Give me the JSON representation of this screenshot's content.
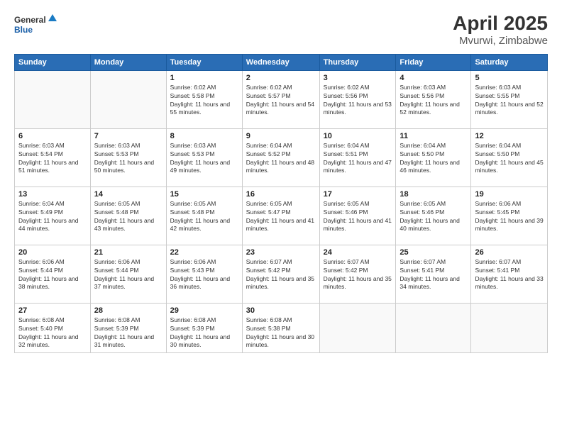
{
  "logo": {
    "general": "General",
    "blue": "Blue"
  },
  "title": "April 2025",
  "subtitle": "Mvurwi, Zimbabwe",
  "headers": [
    "Sunday",
    "Monday",
    "Tuesday",
    "Wednesday",
    "Thursday",
    "Friday",
    "Saturday"
  ],
  "weeks": [
    [
      {
        "day": "",
        "sunrise": "",
        "sunset": "",
        "daylight": ""
      },
      {
        "day": "",
        "sunrise": "",
        "sunset": "",
        "daylight": ""
      },
      {
        "day": "1",
        "sunrise": "Sunrise: 6:02 AM",
        "sunset": "Sunset: 5:58 PM",
        "daylight": "Daylight: 11 hours and 55 minutes."
      },
      {
        "day": "2",
        "sunrise": "Sunrise: 6:02 AM",
        "sunset": "Sunset: 5:57 PM",
        "daylight": "Daylight: 11 hours and 54 minutes."
      },
      {
        "day": "3",
        "sunrise": "Sunrise: 6:02 AM",
        "sunset": "Sunset: 5:56 PM",
        "daylight": "Daylight: 11 hours and 53 minutes."
      },
      {
        "day": "4",
        "sunrise": "Sunrise: 6:03 AM",
        "sunset": "Sunset: 5:56 PM",
        "daylight": "Daylight: 11 hours and 52 minutes."
      },
      {
        "day": "5",
        "sunrise": "Sunrise: 6:03 AM",
        "sunset": "Sunset: 5:55 PM",
        "daylight": "Daylight: 11 hours and 52 minutes."
      }
    ],
    [
      {
        "day": "6",
        "sunrise": "Sunrise: 6:03 AM",
        "sunset": "Sunset: 5:54 PM",
        "daylight": "Daylight: 11 hours and 51 minutes."
      },
      {
        "day": "7",
        "sunrise": "Sunrise: 6:03 AM",
        "sunset": "Sunset: 5:53 PM",
        "daylight": "Daylight: 11 hours and 50 minutes."
      },
      {
        "day": "8",
        "sunrise": "Sunrise: 6:03 AM",
        "sunset": "Sunset: 5:53 PM",
        "daylight": "Daylight: 11 hours and 49 minutes."
      },
      {
        "day": "9",
        "sunrise": "Sunrise: 6:04 AM",
        "sunset": "Sunset: 5:52 PM",
        "daylight": "Daylight: 11 hours and 48 minutes."
      },
      {
        "day": "10",
        "sunrise": "Sunrise: 6:04 AM",
        "sunset": "Sunset: 5:51 PM",
        "daylight": "Daylight: 11 hours and 47 minutes."
      },
      {
        "day": "11",
        "sunrise": "Sunrise: 6:04 AM",
        "sunset": "Sunset: 5:50 PM",
        "daylight": "Daylight: 11 hours and 46 minutes."
      },
      {
        "day": "12",
        "sunrise": "Sunrise: 6:04 AM",
        "sunset": "Sunset: 5:50 PM",
        "daylight": "Daylight: 11 hours and 45 minutes."
      }
    ],
    [
      {
        "day": "13",
        "sunrise": "Sunrise: 6:04 AM",
        "sunset": "Sunset: 5:49 PM",
        "daylight": "Daylight: 11 hours and 44 minutes."
      },
      {
        "day": "14",
        "sunrise": "Sunrise: 6:05 AM",
        "sunset": "Sunset: 5:48 PM",
        "daylight": "Daylight: 11 hours and 43 minutes."
      },
      {
        "day": "15",
        "sunrise": "Sunrise: 6:05 AM",
        "sunset": "Sunset: 5:48 PM",
        "daylight": "Daylight: 11 hours and 42 minutes."
      },
      {
        "day": "16",
        "sunrise": "Sunrise: 6:05 AM",
        "sunset": "Sunset: 5:47 PM",
        "daylight": "Daylight: 11 hours and 41 minutes."
      },
      {
        "day": "17",
        "sunrise": "Sunrise: 6:05 AM",
        "sunset": "Sunset: 5:46 PM",
        "daylight": "Daylight: 11 hours and 41 minutes."
      },
      {
        "day": "18",
        "sunrise": "Sunrise: 6:05 AM",
        "sunset": "Sunset: 5:46 PM",
        "daylight": "Daylight: 11 hours and 40 minutes."
      },
      {
        "day": "19",
        "sunrise": "Sunrise: 6:06 AM",
        "sunset": "Sunset: 5:45 PM",
        "daylight": "Daylight: 11 hours and 39 minutes."
      }
    ],
    [
      {
        "day": "20",
        "sunrise": "Sunrise: 6:06 AM",
        "sunset": "Sunset: 5:44 PM",
        "daylight": "Daylight: 11 hours and 38 minutes."
      },
      {
        "day": "21",
        "sunrise": "Sunrise: 6:06 AM",
        "sunset": "Sunset: 5:44 PM",
        "daylight": "Daylight: 11 hours and 37 minutes."
      },
      {
        "day": "22",
        "sunrise": "Sunrise: 6:06 AM",
        "sunset": "Sunset: 5:43 PM",
        "daylight": "Daylight: 11 hours and 36 minutes."
      },
      {
        "day": "23",
        "sunrise": "Sunrise: 6:07 AM",
        "sunset": "Sunset: 5:42 PM",
        "daylight": "Daylight: 11 hours and 35 minutes."
      },
      {
        "day": "24",
        "sunrise": "Sunrise: 6:07 AM",
        "sunset": "Sunset: 5:42 PM",
        "daylight": "Daylight: 11 hours and 35 minutes."
      },
      {
        "day": "25",
        "sunrise": "Sunrise: 6:07 AM",
        "sunset": "Sunset: 5:41 PM",
        "daylight": "Daylight: 11 hours and 34 minutes."
      },
      {
        "day": "26",
        "sunrise": "Sunrise: 6:07 AM",
        "sunset": "Sunset: 5:41 PM",
        "daylight": "Daylight: 11 hours and 33 minutes."
      }
    ],
    [
      {
        "day": "27",
        "sunrise": "Sunrise: 6:08 AM",
        "sunset": "Sunset: 5:40 PM",
        "daylight": "Daylight: 11 hours and 32 minutes."
      },
      {
        "day": "28",
        "sunrise": "Sunrise: 6:08 AM",
        "sunset": "Sunset: 5:39 PM",
        "daylight": "Daylight: 11 hours and 31 minutes."
      },
      {
        "day": "29",
        "sunrise": "Sunrise: 6:08 AM",
        "sunset": "Sunset: 5:39 PM",
        "daylight": "Daylight: 11 hours and 30 minutes."
      },
      {
        "day": "30",
        "sunrise": "Sunrise: 6:08 AM",
        "sunset": "Sunset: 5:38 PM",
        "daylight": "Daylight: 11 hours and 30 minutes."
      },
      {
        "day": "",
        "sunrise": "",
        "sunset": "",
        "daylight": ""
      },
      {
        "day": "",
        "sunrise": "",
        "sunset": "",
        "daylight": ""
      },
      {
        "day": "",
        "sunrise": "",
        "sunset": "",
        "daylight": ""
      }
    ]
  ]
}
